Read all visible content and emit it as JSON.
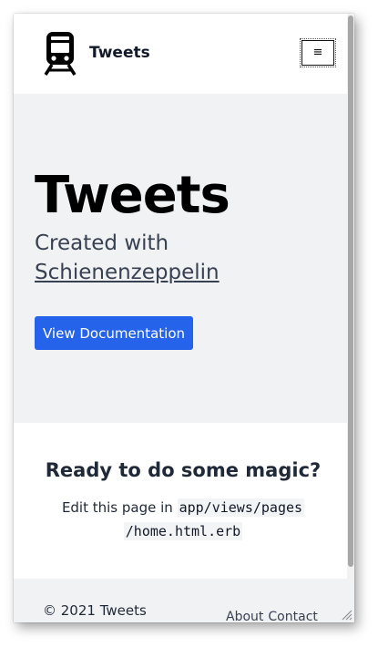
{
  "navbar": {
    "brand": "Tweets",
    "logo_icon": "train-icon",
    "menu_icon": "≡"
  },
  "hero": {
    "title": "Tweets",
    "subtitle_prefix": "Created with",
    "subtitle_link": "Schienenzeppelin",
    "button_label": "View Documentation"
  },
  "magic": {
    "heading": "Ready to do some magic?",
    "text_prefix": "Edit this page in",
    "code_line1": "app/views/pages",
    "code_line2": "/home.html.erb"
  },
  "footer": {
    "copyright": "© 2021 Tweets",
    "links": [
      "About",
      "Contact"
    ]
  },
  "colors": {
    "accent": "#2563eb",
    "hero_bg": "#f1f2f4",
    "text_dark": "#1f2937"
  }
}
